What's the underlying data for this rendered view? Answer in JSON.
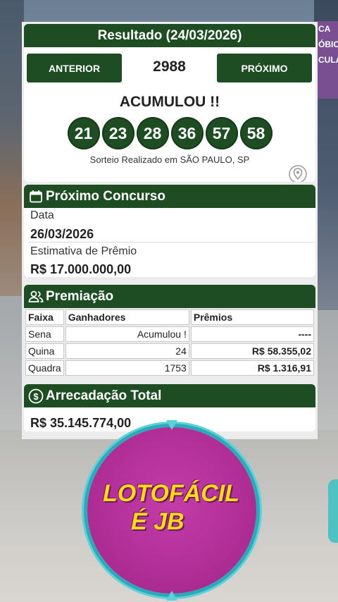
{
  "background_sign_lines": [
    "CA",
    "ÓBICO",
    "CULA"
  ],
  "result": {
    "title": "Resultado (24/03/2026)",
    "prev_label": "ANTERIOR",
    "next_label": "PRÓXIMO",
    "contest_number": "2988",
    "status": "ACUMULOU !!",
    "numbers": [
      "21",
      "23",
      "28",
      "36",
      "57",
      "58"
    ],
    "location": "Sorteio Realizado em SÃO PAULO, SP"
  },
  "next_contest": {
    "title": "Próximo Concurso",
    "date_label": "Data",
    "date_value": "26/03/2026",
    "estimate_label": "Estimativa de Prêmio",
    "estimate_value": "R$ 17.000.000,00"
  },
  "prizes": {
    "title": "Premiação",
    "headers": [
      "Faixa",
      "Ganhadores",
      "Prêmios"
    ],
    "rows": [
      {
        "tier": "Sena",
        "winners": "Acumulou !",
        "prize": "----"
      },
      {
        "tier": "Quina",
        "winners": "24",
        "prize": "R$ 58.355,02"
      },
      {
        "tier": "Quadra",
        "winners": "1753",
        "prize": "R$ 1.316,91"
      }
    ]
  },
  "collection": {
    "title": "Arrecadação Total",
    "value": "R$ 35.145.774,00"
  },
  "logo": {
    "line1": "LOTOFÁCIL",
    "line2": "É JB"
  },
  "colors": {
    "header_green": "#1e4d23",
    "logo_magenta": "#b22f98",
    "logo_yellow": "#ffd91a"
  }
}
